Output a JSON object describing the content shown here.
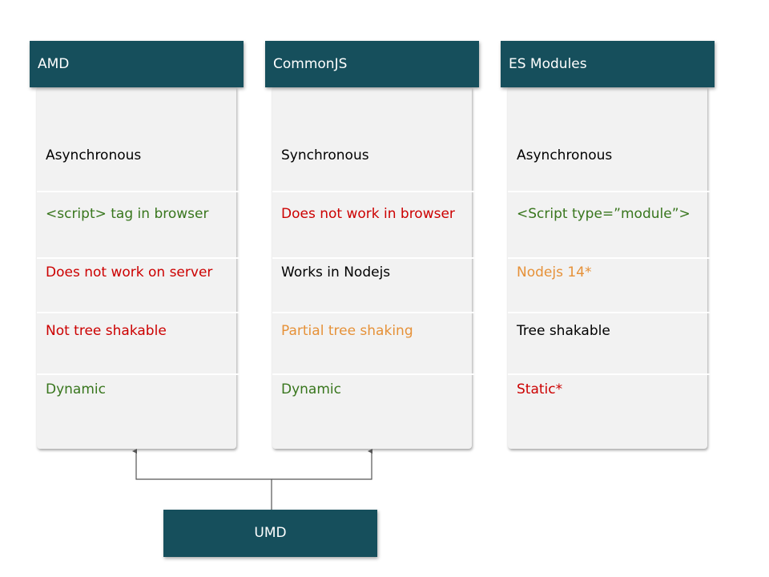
{
  "colors": {
    "header": "#164f5c",
    "green": "#38761d",
    "red": "#cc0000",
    "orange": "#e69138",
    "black": "#000000"
  },
  "columns": [
    {
      "title": "AMD",
      "rows": [
        {
          "text": "Asynchronous",
          "color": "black"
        },
        {
          "text": "<script> tag in browser",
          "color": "green"
        },
        {
          "text": "Does not work on server",
          "color": "red"
        },
        {
          "text": "Not tree shakable",
          "color": "red"
        },
        {
          "text": "Dynamic",
          "color": "green"
        }
      ]
    },
    {
      "title": "CommonJS",
      "rows": [
        {
          "text": "Synchronous",
          "color": "black"
        },
        {
          "text": "Does not work in browser",
          "color": "red"
        },
        {
          "text": "Works in Nodejs",
          "color": "black"
        },
        {
          "text": "Partial tree shaking",
          "color": "orange"
        },
        {
          "text": "Dynamic",
          "color": "green"
        }
      ]
    },
    {
      "title": "ES Modules",
      "rows": [
        {
          "text": "Asynchronous",
          "color": "black"
        },
        {
          "text": "<Script type=”module”>",
          "color": "green"
        },
        {
          "text": "Nodejs 14*",
          "color": "orange"
        },
        {
          "text": "Tree shakable",
          "color": "black"
        },
        {
          "text": "Static*",
          "color": "red"
        }
      ]
    }
  ],
  "umd": {
    "title": "UMD",
    "arrows_to": [
      "AMD",
      "CommonJS"
    ]
  }
}
